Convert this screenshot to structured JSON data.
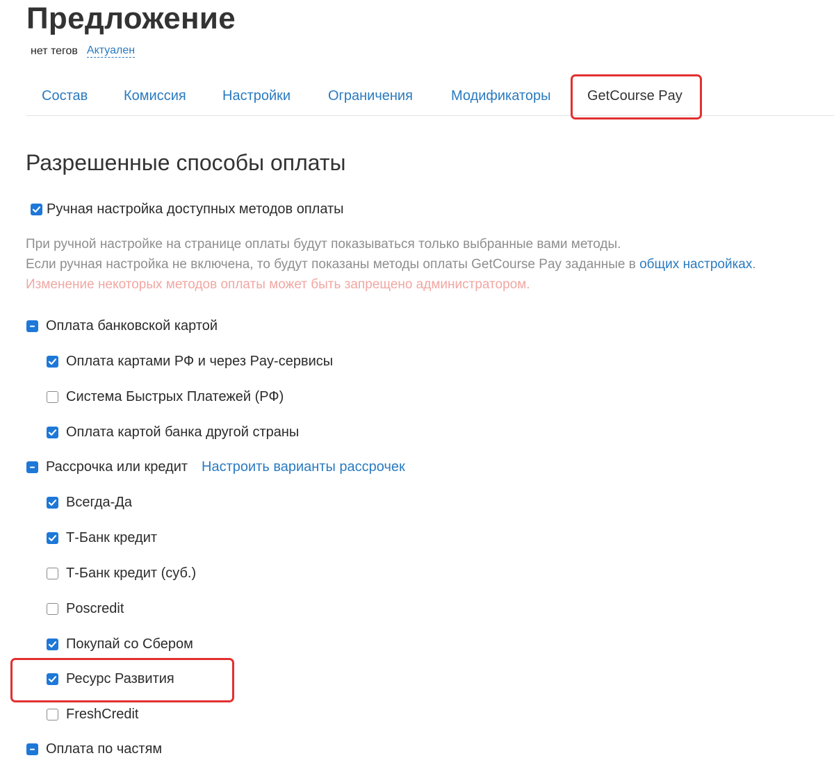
{
  "header": {
    "title": "Предложение",
    "tags": "нет тегов",
    "status": "Актуален"
  },
  "tabs": [
    {
      "label": "Состав"
    },
    {
      "label": "Комиссия"
    },
    {
      "label": "Настройки"
    },
    {
      "label": "Ограничения"
    },
    {
      "label": "Модификаторы"
    },
    {
      "label": "GetCourse Pay",
      "active": true
    }
  ],
  "section": {
    "title": "Разрешенные способы оплаты",
    "manual_setting": {
      "label": "Ручная настройка доступных методов оплаты",
      "checked": true
    },
    "help_line1": "При ручной настройке на странице оплаты будут показываться только выбранные вами методы.",
    "help_line2": "Если ручная настройка не включена, то будут показаны методы оплаты GetCourse Pay заданные в ",
    "help_link": "общих настройках",
    "help_line2_end": ".",
    "warning": "Изменение некоторых методов оплаты может быть запрещено администратором."
  },
  "groups": [
    {
      "label": "Оплата банковской картой",
      "state": "partial",
      "items": [
        {
          "label": "Оплата картами РФ и через Pay-сервисы",
          "checked": true
        },
        {
          "label": "Система Быстрых Платежей (РФ)",
          "checked": false
        },
        {
          "label": "Оплата картой банка другой страны",
          "checked": true
        }
      ]
    },
    {
      "label": "Рассрочка или кредит",
      "state": "partial",
      "link": "Настроить варианты рассрочек",
      "items": [
        {
          "label": "Всегда-Да",
          "checked": true
        },
        {
          "label": "Т-Банк кредит",
          "checked": true
        },
        {
          "label": "Т-Банк кредит (суб.)",
          "checked": false
        },
        {
          "label": "Poscredit",
          "checked": false
        },
        {
          "label": "Покупай со Сбером",
          "checked": true
        },
        {
          "label": "Ресурс Развития",
          "checked": true
        },
        {
          "label": "FreshCredit",
          "checked": false
        }
      ]
    },
    {
      "label": "Оплата по частям",
      "state": "partial",
      "items": []
    }
  ],
  "colors": {
    "accent": "#1d78d8",
    "link": "#2a7abf",
    "highlight": "#e2302f",
    "warning": "#f1a7a2"
  }
}
